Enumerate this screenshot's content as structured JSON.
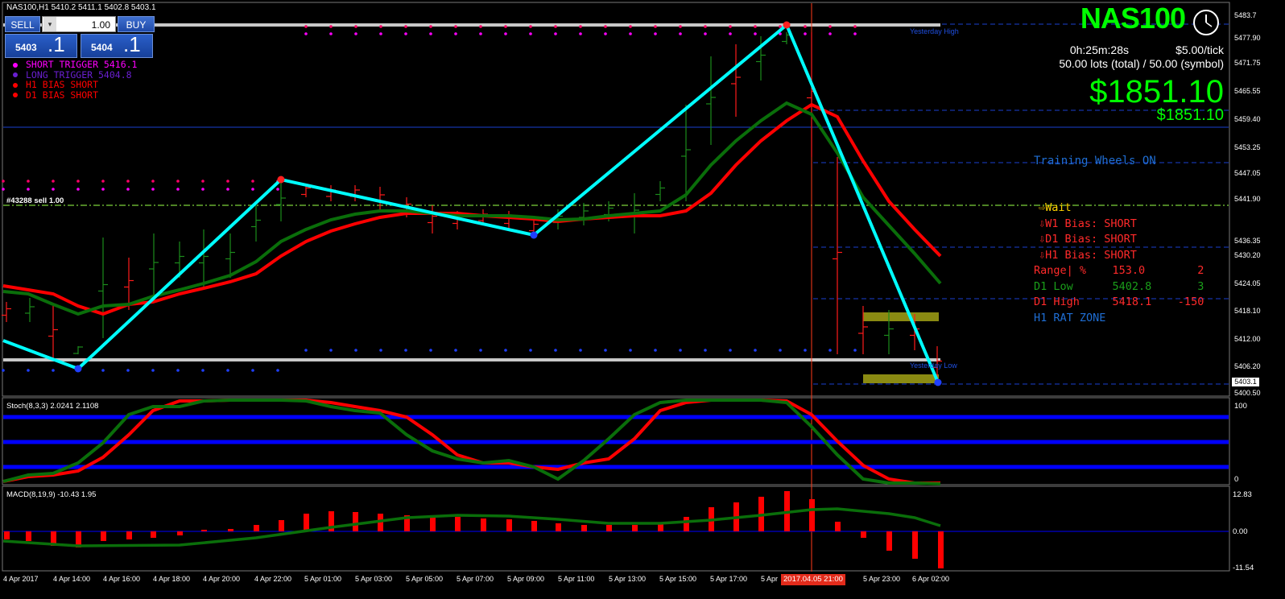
{
  "title": {
    "symbol_line": "NAS100,H1  5410.2 5411.1 5402.8 5403.1"
  },
  "trade_panel": {
    "sell_label": "SELL",
    "buy_label": "BUY",
    "lots": "1.00",
    "bid_small": "5403",
    "bid_big": ".1",
    "ask_small": "5404",
    "ask_big": ".1",
    "spin_down": "▾",
    "spin_up": "▴"
  },
  "legend": [
    {
      "text": "SHORT TRIGGER  5416.1",
      "color": "#ff00ff"
    },
    {
      "text": "LONG TRIGGER   5404.8",
      "color": "#6a1fd1"
    },
    {
      "text": "H1 BIAS SHORT",
      "color": "#ff0000"
    },
    {
      "text": "D1 BIAS SHORT",
      "color": "#ff0000"
    }
  ],
  "order_label": "#43288  sell 1.00",
  "header_right": {
    "symbol": "NAS100",
    "countdown": "0h:25m:28s",
    "tick_value": "$5.00/tick",
    "lots_info": "50.00 lots (total) / 50.00 (symbol)",
    "profit_big": "$1851.10",
    "profit_small": "$1851.10",
    "training": "Training Wheels ON"
  },
  "info_panel": [
    {
      "text": "⇨Wait",
      "color": "#ffd400"
    },
    {
      "text": "⇩W1 Bias: SHORT",
      "color": "#ff2a2a"
    },
    {
      "text": "⇩D1 Bias: SHORT",
      "color": "#ff2a2a"
    },
    {
      "text": "⇩H1 Bias: SHORT",
      "color": "#ff2a2a"
    },
    {
      "text": "Range| %    153.0        2",
      "color": "#ff2a2a"
    },
    {
      "text": "D1 Low      5402.8       3",
      "color": "#1a9e1a"
    },
    {
      "text": "D1 High     5418.1    -150",
      "color": "#ff2a2a"
    },
    {
      "text": "H1 RAT ZONE",
      "color": "#1f6ed4"
    }
  ],
  "yesterday_high": "Yesterday High",
  "yesterday_low": "Yesterday Low",
  "price_axis": [
    "5483.7",
    "5477.90",
    "5471.75",
    "5465.55",
    "5459.40",
    "5453.25",
    "5447.05",
    "5441.90",
    "5436.35",
    "5430.20",
    "5424.05",
    "5418.10",
    "5412.00",
    "5406.20",
    "5400.50"
  ],
  "current_price": "5403.1",
  "stoch": {
    "label": "Stoch(8,3,3) 2.0241 2.1108",
    "axis": [
      "100",
      "0"
    ]
  },
  "macd": {
    "label": "MACD(8,19,9) -10.43 1.95",
    "axis": [
      "12.83",
      "0.00",
      "-11.54"
    ]
  },
  "time_axis": [
    "4 Apr 2017",
    "4 Apr 14:00",
    "4 Apr 16:00",
    "4 Apr 18:00",
    "4 Apr 20:00",
    "4 Apr 22:00",
    "5 Apr 01:00",
    "5 Apr 03:00",
    "5 Apr 05:00",
    "5 Apr 07:00",
    "5 Apr 09:00",
    "5 Apr 11:00",
    "5 Apr 13:00",
    "5 Apr 15:00",
    "5 Apr 17:00",
    "5 Apr",
    "5 Apr 23:00",
    "6 Apr 02:00"
  ],
  "time_highlight": "2017.04.05 21:00",
  "colors": {
    "bg": "#000000",
    "green_text": "#00ff00",
    "zigzag": "#00ffff",
    "ma_red": "#ff0000",
    "ma_green": "#0a6e0a",
    "candle_up": "#1c8c1c",
    "candle_down": "#ff1a1a",
    "grid_blue": "#1a3fd0"
  }
}
